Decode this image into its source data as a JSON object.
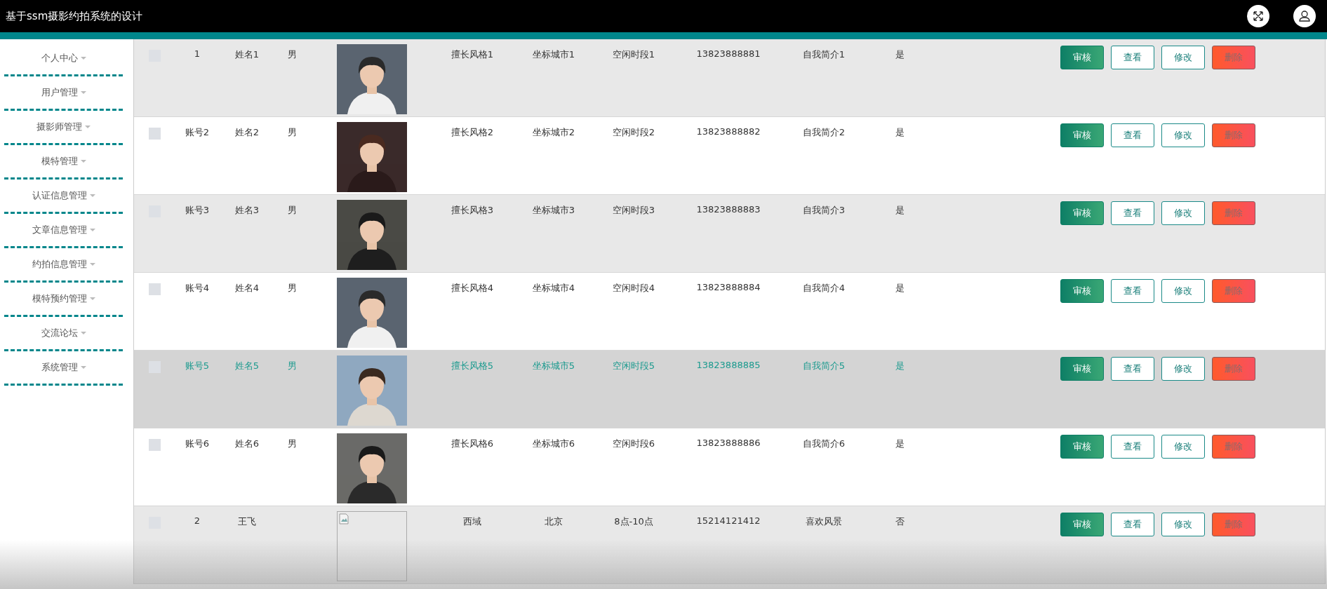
{
  "header": {
    "title": "基于ssm摄影约拍系统的设计"
  },
  "sidebar": {
    "items": [
      {
        "label": "个人中心"
      },
      {
        "label": "用户管理"
      },
      {
        "label": "摄影师管理"
      },
      {
        "label": "模特管理"
      },
      {
        "label": "认证信息管理"
      },
      {
        "label": "文章信息管理"
      },
      {
        "label": "约拍信息管理"
      },
      {
        "label": "模特预约管理"
      },
      {
        "label": "交流论坛"
      },
      {
        "label": "系统管理"
      }
    ]
  },
  "table": {
    "rows": [
      {
        "checked": false,
        "hovered": false,
        "account": "1",
        "name": "姓名1",
        "gender": "男",
        "style": "擅长风格1",
        "city": "坐标城市1",
        "free_time": "空闲时段1",
        "phone": "13823888881",
        "intro": "自我简介1",
        "flag": "是",
        "buttons": [
          {
            "label": "审核",
            "kind": "approve"
          },
          {
            "label": "查看",
            "kind": "outline"
          },
          {
            "label": "修改",
            "kind": "outline"
          },
          {
            "label": "删除",
            "kind": "danger"
          }
        ]
      },
      {
        "checked": false,
        "hovered": false,
        "account": "账号2",
        "name": "姓名2",
        "gender": "男",
        "style": "擅长风格2",
        "city": "坐标城市2",
        "free_time": "空闲时段2",
        "phone": "13823888882",
        "intro": "自我简介2",
        "flag": "是",
        "buttons": [
          {
            "label": "审核",
            "kind": "approve"
          },
          {
            "label": "查看",
            "kind": "outline"
          },
          {
            "label": "修改",
            "kind": "outline"
          },
          {
            "label": "删除",
            "kind": "danger"
          }
        ]
      },
      {
        "checked": false,
        "hovered": false,
        "account": "账号3",
        "name": "姓名3",
        "gender": "男",
        "style": "擅长风格3",
        "city": "坐标城市3",
        "free_time": "空闲时段3",
        "phone": "13823888883",
        "intro": "自我简介3",
        "flag": "是",
        "buttons": [
          {
            "label": "审核",
            "kind": "approve"
          },
          {
            "label": "查看",
            "kind": "outline"
          },
          {
            "label": "修改",
            "kind": "outline"
          },
          {
            "label": "删除",
            "kind": "danger"
          }
        ]
      },
      {
        "checked": false,
        "hovered": false,
        "account": "账号4",
        "name": "姓名4",
        "gender": "男",
        "style": "擅长风格4",
        "city": "坐标城市4",
        "free_time": "空闲时段4",
        "phone": "13823888884",
        "intro": "自我简介4",
        "flag": "是",
        "buttons": [
          {
            "label": "审核",
            "kind": "approve"
          },
          {
            "label": "查看",
            "kind": "outline"
          },
          {
            "label": "修改",
            "kind": "outline"
          },
          {
            "label": "删除",
            "kind": "danger"
          }
        ]
      },
      {
        "checked": false,
        "hovered": true,
        "account": "账号5",
        "name": "姓名5",
        "gender": "男",
        "style": "擅长风格5",
        "city": "坐标城市5",
        "free_time": "空闲时段5",
        "phone": "13823888885",
        "intro": "自我简介5",
        "flag": "是",
        "buttons": [
          {
            "label": "审核",
            "kind": "approve"
          },
          {
            "label": "查看",
            "kind": "outline"
          },
          {
            "label": "修改",
            "kind": "outline"
          },
          {
            "label": "删除",
            "kind": "danger"
          }
        ]
      },
      {
        "checked": false,
        "hovered": false,
        "account": "账号6",
        "name": "姓名6",
        "gender": "男",
        "style": "擅长风格6",
        "city": "坐标城市6",
        "free_time": "空闲时段6",
        "phone": "13823888886",
        "intro": "自我简介6",
        "flag": "是",
        "buttons": [
          {
            "label": "审核",
            "kind": "approve"
          },
          {
            "label": "查看",
            "kind": "outline"
          },
          {
            "label": "修改",
            "kind": "outline"
          },
          {
            "label": "删除",
            "kind": "danger"
          }
        ]
      },
      {
        "checked": false,
        "hovered": false,
        "account": "2",
        "name": "王飞",
        "photo": {
          "kind": "broken"
        },
        "style": "西域",
        "city": "北京",
        "free_time": "8点-10点",
        "phone": "15214121412",
        "intro": "喜欢风景",
        "flag": "否",
        "buttons": [
          {
            "label": "审核",
            "kind": "approve"
          },
          {
            "label": "查看",
            "kind": "outline"
          },
          {
            "label": "修改",
            "kind": "outline"
          },
          {
            "label": "删除",
            "kind": "danger"
          }
        ]
      }
    ]
  }
}
